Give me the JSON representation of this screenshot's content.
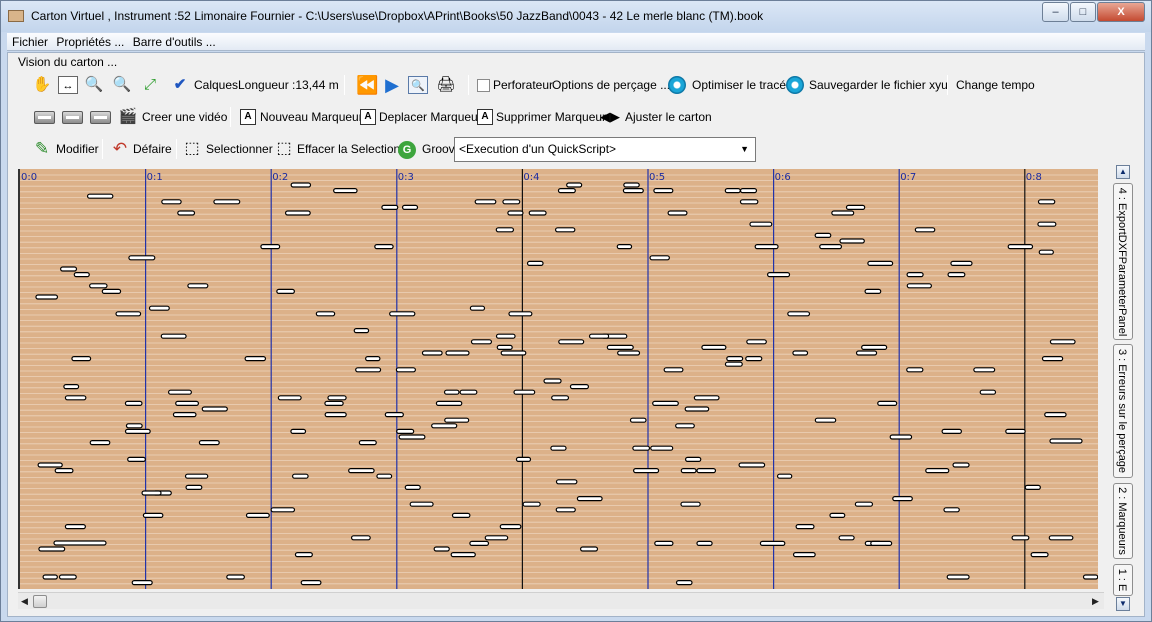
{
  "window": {
    "title": "Carton Virtuel , Instrument :52 Limonaire Fournier - C:\\Users\\use\\Dropbox\\APrint\\Books\\50 JazzBand\\0043 - 42 Le merle blanc (TM).book",
    "minimize": "–",
    "maximize": "□",
    "close": "X"
  },
  "menu": {
    "file": "Fichier",
    "properties": "Propriétés ...",
    "toolbar": "Barre d'outils ..."
  },
  "section_label": "Vision du carton ...",
  "toolbar1": {
    "layers": "Calques",
    "length": "Longueur :13,44 m",
    "punch": "Perforateur",
    "punch_options": "Options de perçage ...",
    "optimize": "Optimiser le tracé",
    "save_xyu": "Sauvegarder le fichier xyu",
    "change_tempo": "Change tempo"
  },
  "toolbar2": {
    "create_video": "Creer une vidéo",
    "new_marker": "Nouveau Marqueur",
    "move_marker": "Deplacer Marqueur",
    "delete_marker": "Supprimer Marqueur",
    "adjust": "Ajuster le carton"
  },
  "toolbar3": {
    "modify": "Modifier",
    "undo": "Défaire",
    "select": "Selectionner",
    "clear_selection": "Effacer la Selection",
    "groovy": "Groovy",
    "quickscript": "<Execution d'un QuickScript>"
  },
  "canvas": {
    "time_labels": [
      "0:0",
      "0:1",
      "0:2",
      "0:3",
      "0:4",
      "0:5",
      "0:6",
      "0:7",
      "0:8"
    ],
    "bg_color": "#dcb189",
    "measure_color": "#2233aa"
  },
  "side_tabs": [
    "4 : ExportDXFParameterPanel",
    "3 : Erreurs sur le perçage",
    "2 : Marqueurs",
    "1 : E"
  ],
  "icons": {
    "hand": "hand-icon",
    "fit": "fit-icon",
    "zoom_in": "zoom-in-icon",
    "zoom_out": "zoom-out-icon",
    "expand": "expand-icon",
    "check": "checkmark-icon",
    "rewind": "rewind-icon",
    "play": "play-icon",
    "preview": "preview-icon",
    "print": "print-icon"
  }
}
